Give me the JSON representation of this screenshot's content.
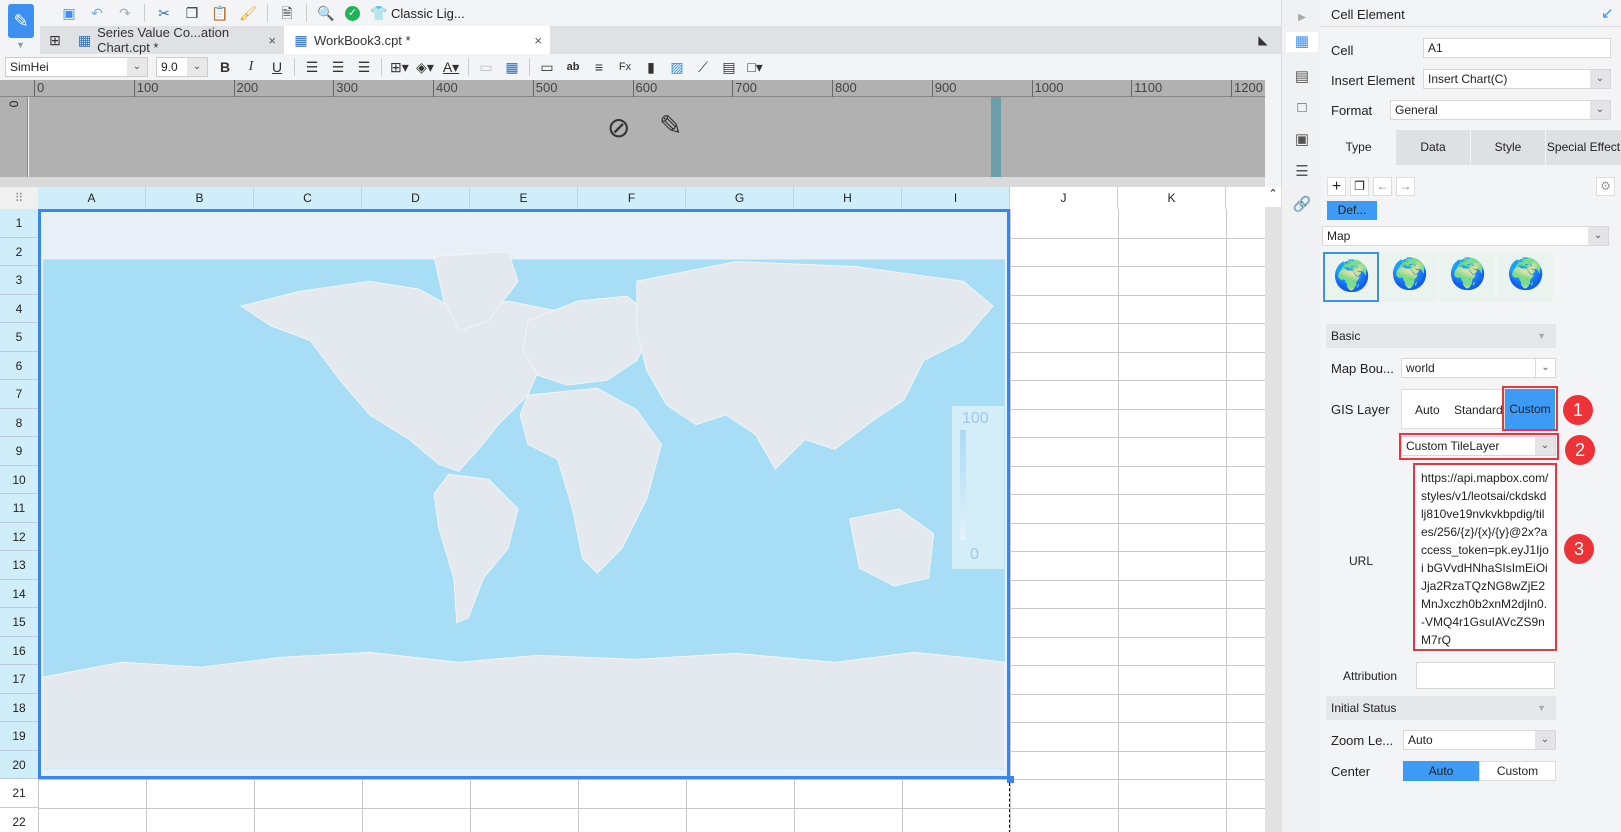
{
  "toolbar": {
    "classic_label": "Classic Lig...",
    "icons": [
      "save-icon",
      "undo-icon",
      "redo-icon",
      "cut-icon",
      "copy-icon",
      "paste-icon",
      "format-painter-icon",
      "preview-icon",
      "check-icon",
      "theme-icon"
    ]
  },
  "tabs": [
    {
      "label": "Series Value Co...ation Chart.cpt *"
    },
    {
      "label": "WorkBook3.cpt *"
    }
  ],
  "format": {
    "font": "SimHei",
    "size": "9.0",
    "bold": "B",
    "italic": "I",
    "underline": "U"
  },
  "ruler": [
    "0",
    "100",
    "200",
    "300",
    "400",
    "500",
    "600",
    "700",
    "800",
    "900",
    "1000",
    "1100",
    "1200"
  ],
  "vruler": "0",
  "columns": [
    "A",
    "B",
    "C",
    "D",
    "E",
    "F",
    "G",
    "H",
    "I",
    "J",
    "K"
  ],
  "rows": [
    "1",
    "2",
    "3",
    "4",
    "5",
    "6",
    "7",
    "8",
    "9",
    "10",
    "11",
    "12",
    "13",
    "14",
    "15",
    "16",
    "17",
    "18",
    "19",
    "20",
    "21",
    "22"
  ],
  "legend": {
    "max": "100",
    "min": "0"
  },
  "colors": {
    "accent": "#3d8ff0",
    "ocean": "#a8def5",
    "land": "#e3e9ee",
    "badge": "#ee3338"
  },
  "panel": {
    "title": "Cell Element",
    "cell_label": "Cell",
    "cell_value": "A1",
    "insert_label": "Insert Element",
    "insert_value": "Insert Chart(C)",
    "format_label": "Format",
    "format_value": "General",
    "tabs": [
      "Type",
      "Data",
      "Style",
      "Special Effect"
    ],
    "default_btn": "Def...",
    "chart_type": "Map",
    "basic": "Basic",
    "map_boundary_label": "Map Bou...",
    "map_boundary_value": "world",
    "gis_label": "GIS Layer",
    "gis_options": [
      "Auto",
      "Standard",
      "Custom"
    ],
    "tile_layer": "Custom TileLayer",
    "url_label": "URL",
    "url_value": "https://api.mapbox.com/styles/v1/leotsai/ckdskdlj810ve19nvkvkbpdig/tiles/256/{z}/{x}/{y}@2x?access_token=pk.eyJ1Ijoi bGVvdHNhaSIsImEiOiJja2RzaTQzNG8wZjE2MnJxczh0b2xnM2djIn0.-VMQ4r1GsuIAVcZS9nM7rQ",
    "attribution_label": "Attribution",
    "attribution_value": "",
    "initial_status": "Initial Status",
    "zoom_label": "Zoom Le...",
    "zoom_value": "Auto",
    "center_label": "Center",
    "center_options": [
      "Auto",
      "Custom"
    ],
    "badges": [
      "1",
      "2",
      "3"
    ]
  }
}
